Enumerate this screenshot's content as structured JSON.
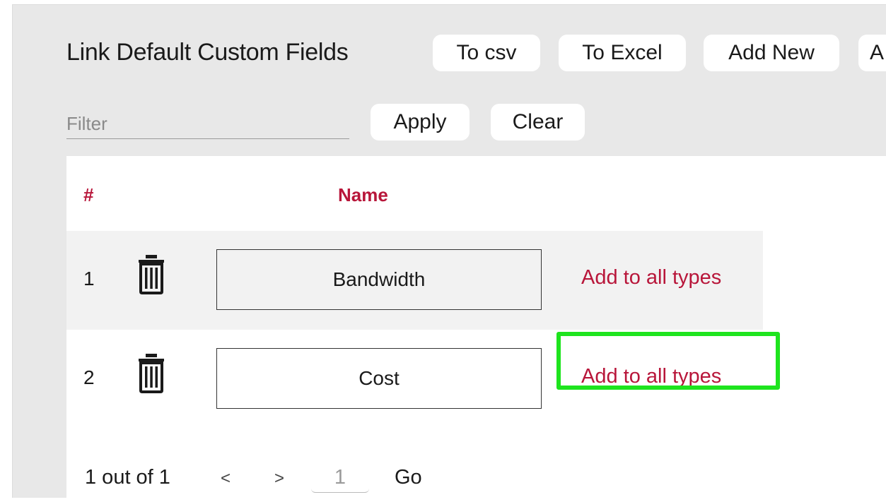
{
  "header": {
    "title": "Link Default Custom Fields",
    "buttons": {
      "to_csv": "To csv",
      "to_excel": "To Excel",
      "add_new": "Add New",
      "truncated": "A"
    }
  },
  "filter": {
    "placeholder": "Filter",
    "value": "",
    "apply_label": "Apply",
    "clear_label": "Clear"
  },
  "table": {
    "headers": {
      "number": "#",
      "name": "Name"
    },
    "rows": [
      {
        "number": "1",
        "name": "Bandwidth",
        "action": "Add to all types"
      },
      {
        "number": "2",
        "name": "Cost",
        "action": "Add to all types"
      }
    ]
  },
  "pagination": {
    "summary": "1 out of 1",
    "prev": "<",
    "next": ">",
    "page": "1",
    "go_label": "Go"
  },
  "colors": {
    "accent": "#b8163a",
    "highlight": "#1ee41e",
    "panel_bg": "#e8e8e8"
  },
  "icons": {
    "delete": "trash-icon"
  }
}
